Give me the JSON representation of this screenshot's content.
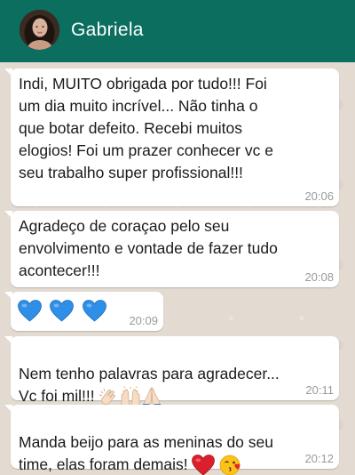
{
  "header": {
    "contact_name": "Gabriela",
    "avatar_icon": "contact-avatar-photo",
    "background_color": "#0b6e5f"
  },
  "messages": [
    {
      "text": "Indi, MUITO obrigada por tudo!!! Foi\num dia muito incrível... Não tinha o\nque botar defeito. Recebi muitos\nelogios! Foi um prazer conhecer vc e\nseu trabalho super profissional!!!",
      "time": "20:06"
    },
    {
      "text": "Agradeço de coraçao pelo seu\nenvolvimento e vontade de fazer tudo\nacontecer!!!",
      "time": "20:08"
    },
    {
      "text": "",
      "emojis": [
        "blue-heart-icon",
        "blue-heart-icon",
        "blue-heart-icon"
      ],
      "time": "20:09"
    },
    {
      "text": "Nem tenho palavras para agradecer...\nVc foi mil!!!",
      "emojis": [
        "clapping-hands-icon",
        "raising-hands-icon",
        "folded-hands-icon"
      ],
      "time": "20:11"
    },
    {
      "text": "Manda beijo para as meninas do seu\ntime, elas foram demais!",
      "emojis": [
        "red-heart-icon",
        "face-blowing-kiss-icon"
      ],
      "time": "20:12"
    }
  ],
  "colors": {
    "bubble_background": "#ffffff",
    "chat_background": "#e3dbd2",
    "timestamp": "#9a9a9a"
  }
}
